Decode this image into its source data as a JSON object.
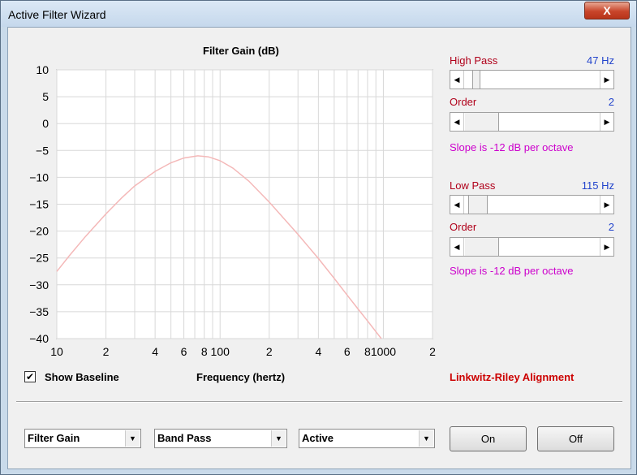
{
  "window": {
    "title": "Active Filter Wizard",
    "close_label": "X"
  },
  "chart_data": {
    "type": "line",
    "title": "Filter Gain (dB)",
    "xlabel": "Frequency (hertz)",
    "ylabel": "",
    "x_scale": "log",
    "xlim": [
      10,
      2000
    ],
    "ylim": [
      -40,
      10
    ],
    "y_ticks": [
      "10",
      "5",
      "0",
      "−5",
      "−10",
      "−15",
      "−20",
      "−25",
      "−30",
      "−35",
      "−40"
    ],
    "x_ticks": [
      "10",
      "2",
      "4",
      "6",
      "8",
      "100",
      "2",
      "4",
      "6",
      "8",
      "1000",
      "2"
    ],
    "grid": true,
    "series": [
      {
        "color": "#f4b8b8",
        "x": [
          10,
          12,
          15,
          20,
          25,
          30,
          40,
          50,
          60,
          73,
          85,
          100,
          120,
          150,
          200,
          250,
          300,
          400,
          500,
          600,
          700,
          800,
          1000
        ],
        "y": [
          -27.5,
          -24.5,
          -21.0,
          -16.8,
          -13.8,
          -11.6,
          -8.9,
          -7.3,
          -6.4,
          -6.0,
          -6.2,
          -6.9,
          -8.3,
          -10.7,
          -14.6,
          -17.9,
          -20.6,
          -25.1,
          -28.8,
          -31.9,
          -34.5,
          -36.7,
          -40.5
        ]
      }
    ]
  },
  "highpass": {
    "label": "High Pass",
    "value": "47 Hz",
    "order_label": "Order",
    "order_value": "2",
    "slope": "Slope is -12 dB per octave"
  },
  "lowpass": {
    "label": "Low Pass",
    "value": "115 Hz",
    "order_label": "Order",
    "order_value": "2",
    "slope": "Slope is -12 dB per octave"
  },
  "controls": {
    "show_baseline": "Show Baseline",
    "show_baseline_checked": true,
    "alignment": "Linkwitz-Riley Alignment",
    "select1": "Filter Gain",
    "select2": "Band Pass",
    "select3": "Active",
    "on_label": "On",
    "off_label": "Off"
  },
  "colors": {
    "curve": "#f4b8b8",
    "highlight_red": "#b0001a",
    "value_blue": "#2244cc",
    "slope_magenta": "#cc00cc"
  }
}
